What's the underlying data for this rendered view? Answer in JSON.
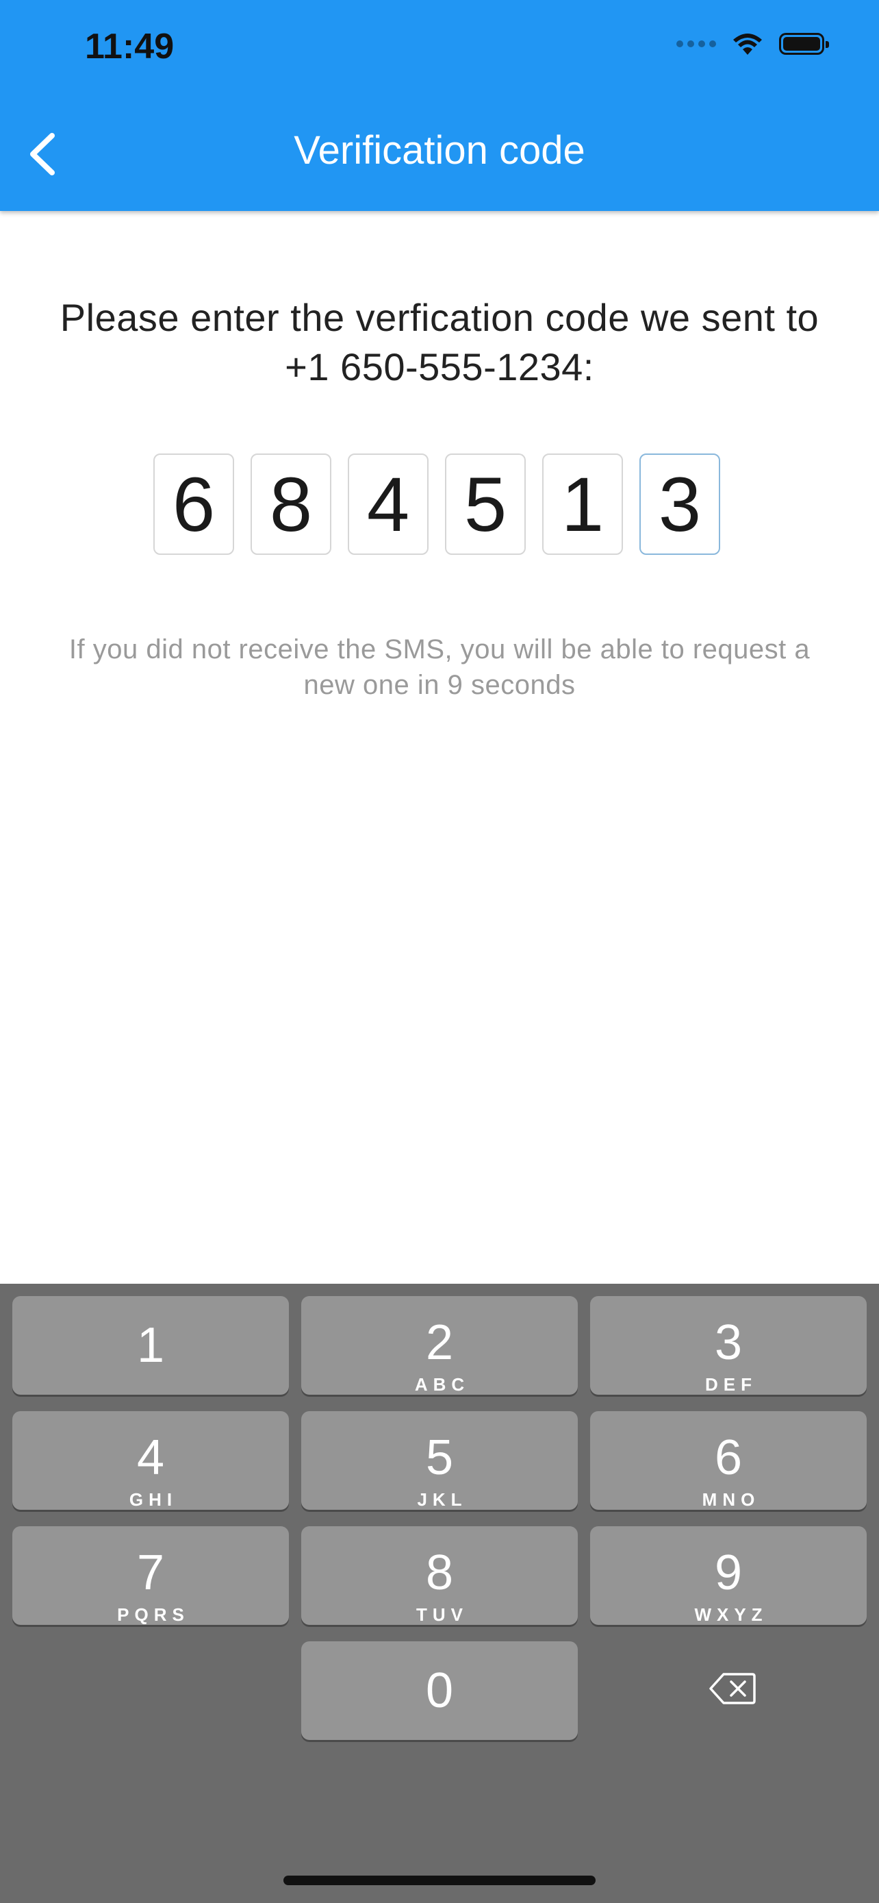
{
  "status_bar": {
    "time": "11:49"
  },
  "header": {
    "title": "Verification code"
  },
  "instruction": "Please enter the verfication code we sent to +1 650-555-1234:",
  "code_digits": [
    "6",
    "8",
    "4",
    "5",
    "1",
    "3"
  ],
  "resend_hint": "If you did not receive the SMS, you will be able to request a new one in 9 seconds",
  "keypad": {
    "keys": [
      {
        "num": "1",
        "letters": ""
      },
      {
        "num": "2",
        "letters": "ABC"
      },
      {
        "num": "3",
        "letters": "DEF"
      },
      {
        "num": "4",
        "letters": "GHI"
      },
      {
        "num": "5",
        "letters": "JKL"
      },
      {
        "num": "6",
        "letters": "MNO"
      },
      {
        "num": "7",
        "letters": "PQRS"
      },
      {
        "num": "8",
        "letters": "TUV"
      },
      {
        "num": "9",
        "letters": "WXYZ"
      },
      {
        "num": "0",
        "letters": ""
      }
    ]
  },
  "colors": {
    "primary": "#2196F3",
    "keyboard_bg": "#6b6b6b",
    "key_bg": "#959595"
  }
}
